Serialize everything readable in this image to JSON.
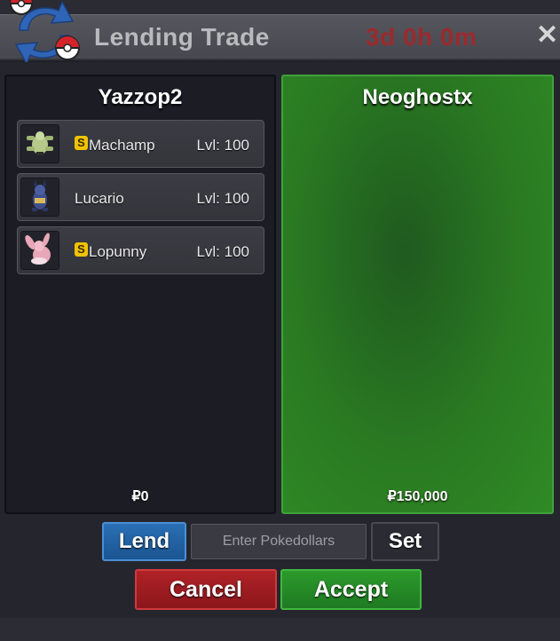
{
  "window": {
    "title": "Lending Trade",
    "timer": "3d 0h 0m",
    "close_glyph": "✕",
    "logo_icon": "trade-pokeball-arrows-icon"
  },
  "left_panel": {
    "player": "Yazzop2",
    "money": "₽0",
    "pokemon": [
      {
        "badge": "S",
        "name": "Machamp",
        "level": "Lvl: 100",
        "shiny": true,
        "sprite": "machamp-sprite-icon"
      },
      {
        "badge": "",
        "name": "Lucario",
        "level": "Lvl: 100",
        "shiny": false,
        "sprite": "lucario-sprite-icon"
      },
      {
        "badge": "S",
        "name": "Lopunny",
        "level": "Lvl: 100",
        "shiny": true,
        "sprite": "lopunny-sprite-icon"
      }
    ]
  },
  "right_panel": {
    "player": "Neoghostx",
    "money": "₽150,000"
  },
  "controls": {
    "lend_label": "Lend",
    "pokedollar_placeholder": "Enter Pokedollars",
    "set_label": "Set",
    "cancel_label": "Cancel",
    "accept_label": "Accept"
  },
  "colors": {
    "accent_green": "#2f8a24",
    "accent_red": "#b02227",
    "accent_blue": "#2a6fb5",
    "timer_red": "#9a2a2e",
    "shiny_gold": "#f0c300"
  }
}
